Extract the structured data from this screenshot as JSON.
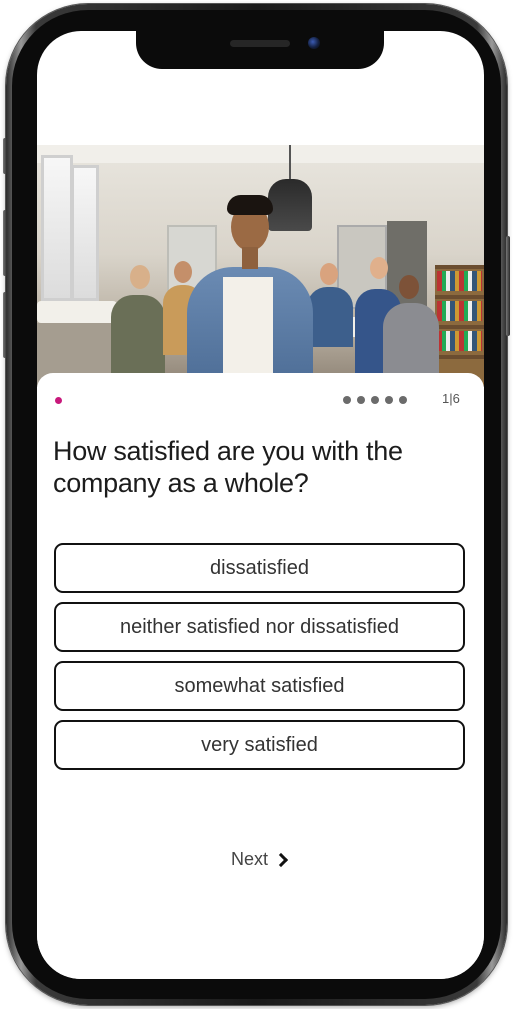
{
  "progress": {
    "total_steps": 5,
    "counter_text": "1|6",
    "active_color": "#c8187b"
  },
  "question": {
    "text": "How satisfied are you with the company as a whole?"
  },
  "options": [
    {
      "label": "dissatisfied"
    },
    {
      "label": "neither satisfied nor dissatisfied"
    },
    {
      "label": "somewhat satisfied"
    },
    {
      "label": "very satisfied"
    }
  ],
  "navigation": {
    "next_label": "Next",
    "next_icon": "chevron-right-icon"
  },
  "header_image": {
    "subject": "office-team-photo"
  }
}
